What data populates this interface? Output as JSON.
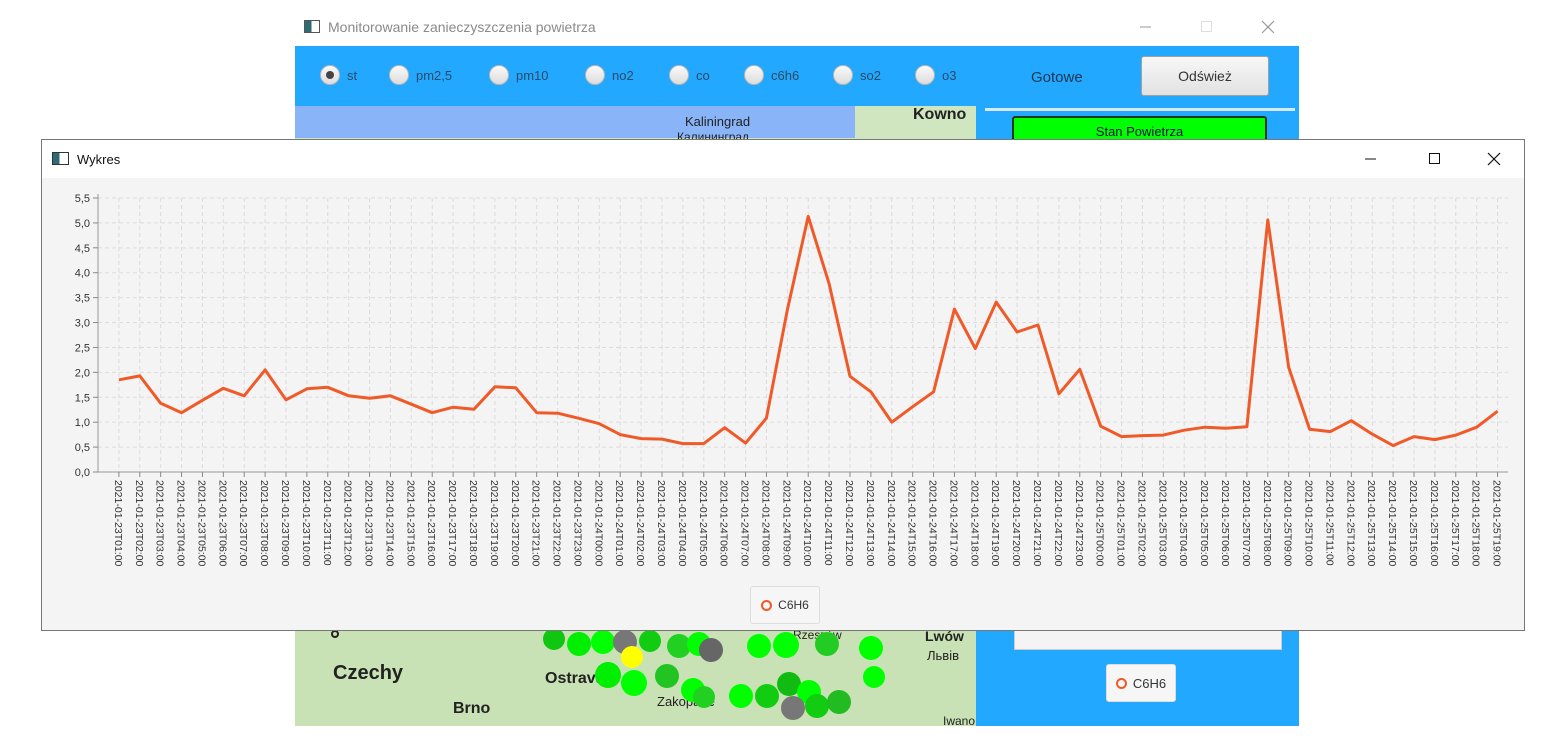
{
  "main_window": {
    "title": "Monitorowanie zanieczyszczenia powietrza",
    "radios": [
      {
        "label": "st",
        "selected": true
      },
      {
        "label": "pm2,5",
        "selected": false
      },
      {
        "label": "pm10",
        "selected": false
      },
      {
        "label": "no2",
        "selected": false
      },
      {
        "label": "co",
        "selected": false
      },
      {
        "label": "c6h6",
        "selected": false
      },
      {
        "label": "so2",
        "selected": false
      },
      {
        "label": "o3",
        "selected": false
      }
    ],
    "status": "Gotowe",
    "refresh_label": "Odśwież",
    "air_state_label": "Stan Powietrza",
    "mini_legend": "C6H6",
    "map_labels": {
      "kaliningrad": "Kaliningrad",
      "kaliningrad_ru": "Калининград",
      "kowno": "Kowno",
      "czechy": "Czechy",
      "ostrava": "Ostrava",
      "brno": "Brno",
      "zakopane": "Zakopane",
      "rzeszow": "Rzeszów",
      "lwow": "Lwów",
      "lviv": "Львів",
      "iwano": "Iwano"
    },
    "colors": {
      "toolbar": "#22a9ff",
      "air_state": "#00ff00"
    }
  },
  "chart_window": {
    "title": "Wykres",
    "legend_label": "C6H6"
  },
  "chart_data": {
    "type": "line",
    "title": "",
    "xlabel": "",
    "ylabel": "",
    "ylim": [
      0,
      5.5
    ],
    "yticks": [
      "0,0",
      "0,5",
      "1,0",
      "1,5",
      "2,0",
      "2,5",
      "3,0",
      "3,5",
      "4,0",
      "4,5",
      "5,0",
      "5,5"
    ],
    "grid": true,
    "legend_placement": "bottom-center",
    "series_color": "#f05a28",
    "x": [
      "2021-01-23T01:00",
      "2021-01-23T02:00",
      "2021-01-23T03:00",
      "2021-01-23T04:00",
      "2021-01-23T05:00",
      "2021-01-23T06:00",
      "2021-01-23T07:00",
      "2021-01-23T08:00",
      "2021-01-23T09:00",
      "2021-01-23T10:00",
      "2021-01-23T11:00",
      "2021-01-23T12:00",
      "2021-01-23T13:00",
      "2021-01-23T14:00",
      "2021-01-23T15:00",
      "2021-01-23T16:00",
      "2021-01-23T17:00",
      "2021-01-23T18:00",
      "2021-01-23T19:00",
      "2021-01-23T20:00",
      "2021-01-23T21:00",
      "2021-01-23T22:00",
      "2021-01-23T23:00",
      "2021-01-24T00:00",
      "2021-01-24T01:00",
      "2021-01-24T02:00",
      "2021-01-24T03:00",
      "2021-01-24T04:00",
      "2021-01-24T05:00",
      "2021-01-24T06:00",
      "2021-01-24T07:00",
      "2021-01-24T08:00",
      "2021-01-24T09:00",
      "2021-01-24T10:00",
      "2021-01-24T11:00",
      "2021-01-24T12:00",
      "2021-01-24T13:00",
      "2021-01-24T14:00",
      "2021-01-24T15:00",
      "2021-01-24T16:00",
      "2021-01-24T17:00",
      "2021-01-24T18:00",
      "2021-01-24T19:00",
      "2021-01-24T20:00",
      "2021-01-24T21:00",
      "2021-01-24T22:00",
      "2021-01-24T23:00",
      "2021-01-25T00:00",
      "2021-01-25T01:00",
      "2021-01-25T02:00",
      "2021-01-25T03:00",
      "2021-01-25T04:00",
      "2021-01-25T05:00",
      "2021-01-25T06:00",
      "2021-01-25T07:00",
      "2021-01-25T08:00",
      "2021-01-25T09:00",
      "2021-01-25T10:00",
      "2021-01-25T11:00",
      "2021-01-25T12:00",
      "2021-01-25T13:00",
      "2021-01-25T14:00",
      "2021-01-25T15:00",
      "2021-01-25T16:00",
      "2021-01-25T17:00",
      "2021-01-25T18:00",
      "2021-01-25T19:00"
    ],
    "series": [
      {
        "name": "C6H6",
        "values": [
          1.85,
          1.93,
          1.38,
          1.19,
          1.44,
          1.68,
          1.53,
          2.05,
          1.45,
          1.67,
          1.7,
          1.53,
          1.48,
          1.53,
          1.36,
          1.19,
          1.3,
          1.26,
          1.71,
          1.69,
          1.19,
          1.18,
          1.08,
          0.97,
          0.75,
          0.67,
          0.66,
          0.57,
          0.57,
          0.89,
          0.58,
          1.08,
          3.25,
          5.13,
          3.78,
          1.92,
          1.61,
          1.0,
          1.31,
          1.61,
          3.27,
          2.48,
          3.41,
          2.81,
          2.95,
          1.57,
          2.06,
          0.92,
          0.71,
          0.73,
          0.74,
          0.84,
          0.9,
          0.88,
          0.91,
          5.06,
          2.1,
          0.86,
          0.81,
          1.03,
          0.76,
          0.53,
          0.71,
          0.65,
          0.74,
          0.9,
          1.22
        ]
      }
    ]
  }
}
